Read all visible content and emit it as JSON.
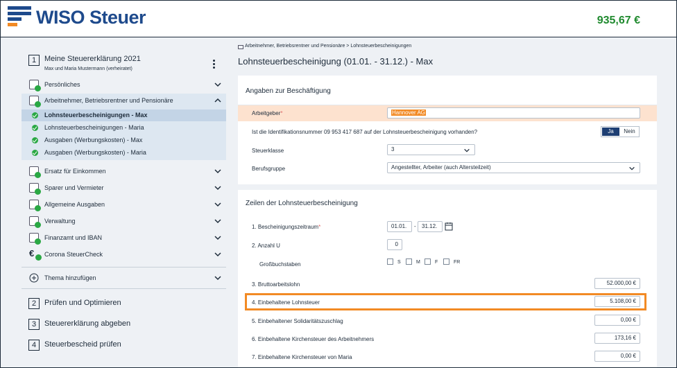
{
  "header": {
    "brand": "WISO Steuer",
    "refund": "935,67 €"
  },
  "sidebar": {
    "step1": {
      "num": "1",
      "title": "Meine Steuererklärung 2021",
      "subtitle": "Max und Maria Mustermann (verheiratet)"
    },
    "sections": [
      {
        "label": "Persönliches",
        "icon": "person-card-icon"
      },
      {
        "label": "Arbeitnehmer, Betriebsrentner und Pensionäre",
        "icon": "briefcase-icon"
      }
    ],
    "subitems": [
      {
        "label": "Lohnsteuerbescheinigungen - Max"
      },
      {
        "label": "Lohnsteuerbescheinigungen - Maria"
      },
      {
        "label": "Ausgaben (Werbungskosten) - Max"
      },
      {
        "label": "Ausgaben (Werbungskosten) - Maria"
      }
    ],
    "more_sections": [
      {
        "label": "Ersatz für Einkommen",
        "icon": "hand-coin-icon"
      },
      {
        "label": "Sparer und Vermieter",
        "icon": "piggy-bank-icon"
      },
      {
        "label": "Allgemeine Ausgaben",
        "icon": "wallet-icon"
      },
      {
        "label": "Verwaltung",
        "icon": "calculator-icon"
      },
      {
        "label": "Finanzamt und IBAN",
        "icon": "bank-icon"
      },
      {
        "label": "Corona SteuerCheck",
        "icon": "euro-icon"
      }
    ],
    "add_topic": "Thema hinzufügen",
    "steps": [
      {
        "num": "2",
        "label": "Prüfen und Optimieren"
      },
      {
        "num": "3",
        "label": "Steuererklärung abgeben"
      },
      {
        "num": "4",
        "label": "Steuerbescheid prüfen"
      }
    ]
  },
  "main": {
    "breadcrumb": "Arbeitnehmer, Betriebsrentner und Pensionäre > Lohnsteuerbescheinigungen",
    "title": "Lohnsteuerbescheinigung (01.01. - 31.12.) - Max",
    "card1": {
      "title": "Angaben zur Beschäftigung",
      "employer_label": "Arbeitgeber",
      "employer_value": "Hannover AG",
      "id_question": "Ist die Identifikationsnummer 09 953 417 687 auf der Lohnsteuerbescheinigung vorhanden?",
      "yes": "Ja",
      "no": "Nein",
      "taxclass_label": "Steuerklasse",
      "taxclass_value": "3",
      "group_label": "Berufsgruppe",
      "group_value": "Angestellter, Arbeiter (auch Altersteilzeit)"
    },
    "card2": {
      "title": "Zeilen der Lohnsteuerbescheinigung",
      "period_label": "1. Bescheinigungszeitraum",
      "period_from": "01.01.",
      "period_sep": "-",
      "period_to": "31.12.",
      "countU_label": "2. Anzahl U",
      "countU_value": "0",
      "letters_label": "Großbuchstaben",
      "letters": [
        "S",
        "M",
        "F",
        "FR"
      ],
      "gross_label": "3. Bruttoarbeitslohn",
      "gross_value": "52.000,00 €",
      "incometax_label": "4. Einbehaltene Lohnsteuer",
      "incometax_value": "5.108,00 €",
      "soli_label": "5. Einbehaltener Solidaritätszuschlag",
      "soli_value": "0,00 €",
      "church_emp_label": "6. Einbehaltene Kirchensteuer des Arbeitnehmers",
      "church_emp_value": "173,16 €",
      "church_maria_label": "7. Einbehaltene Kirchensteuer von Maria",
      "church_maria_value": "0,00 €"
    }
  }
}
